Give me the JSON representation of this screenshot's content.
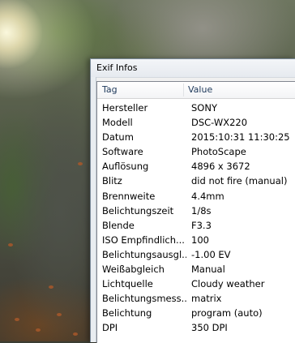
{
  "window": {
    "title": "Exif Infos"
  },
  "columns": {
    "tag": "Tag",
    "value": "Value"
  },
  "rows": [
    {
      "tag": "Hersteller",
      "value": "SONY"
    },
    {
      "tag": "Modell",
      "value": "DSC-WX220"
    },
    {
      "tag": "Datum",
      "value": "2015:10:31 11:30:25"
    },
    {
      "tag": "Software",
      "value": "PhotoScape"
    },
    {
      "tag": "Auflösung",
      "value": "4896 x 3672"
    },
    {
      "tag": "Blitz",
      "value": "did not fire (manual)"
    },
    {
      "tag": "Brennweite",
      "value": "4.4mm"
    },
    {
      "tag": "Belichtungszeit",
      "value": "1/8s"
    },
    {
      "tag": "Blende",
      "value": "F3.3"
    },
    {
      "tag": "ISO Empfindlich...",
      "value": "100"
    },
    {
      "tag": "Belichtungsausgl...",
      "value": "-1.00 EV"
    },
    {
      "tag": "Weißabgleich",
      "value": "Manual"
    },
    {
      "tag": "Lichtquelle",
      "value": "Cloudy weather"
    },
    {
      "tag": "Belichtungsmess...",
      "value": "matrix"
    },
    {
      "tag": "Belichtung",
      "value": "program (auto)"
    },
    {
      "tag": "DPI",
      "value": "350 DPI"
    }
  ]
}
